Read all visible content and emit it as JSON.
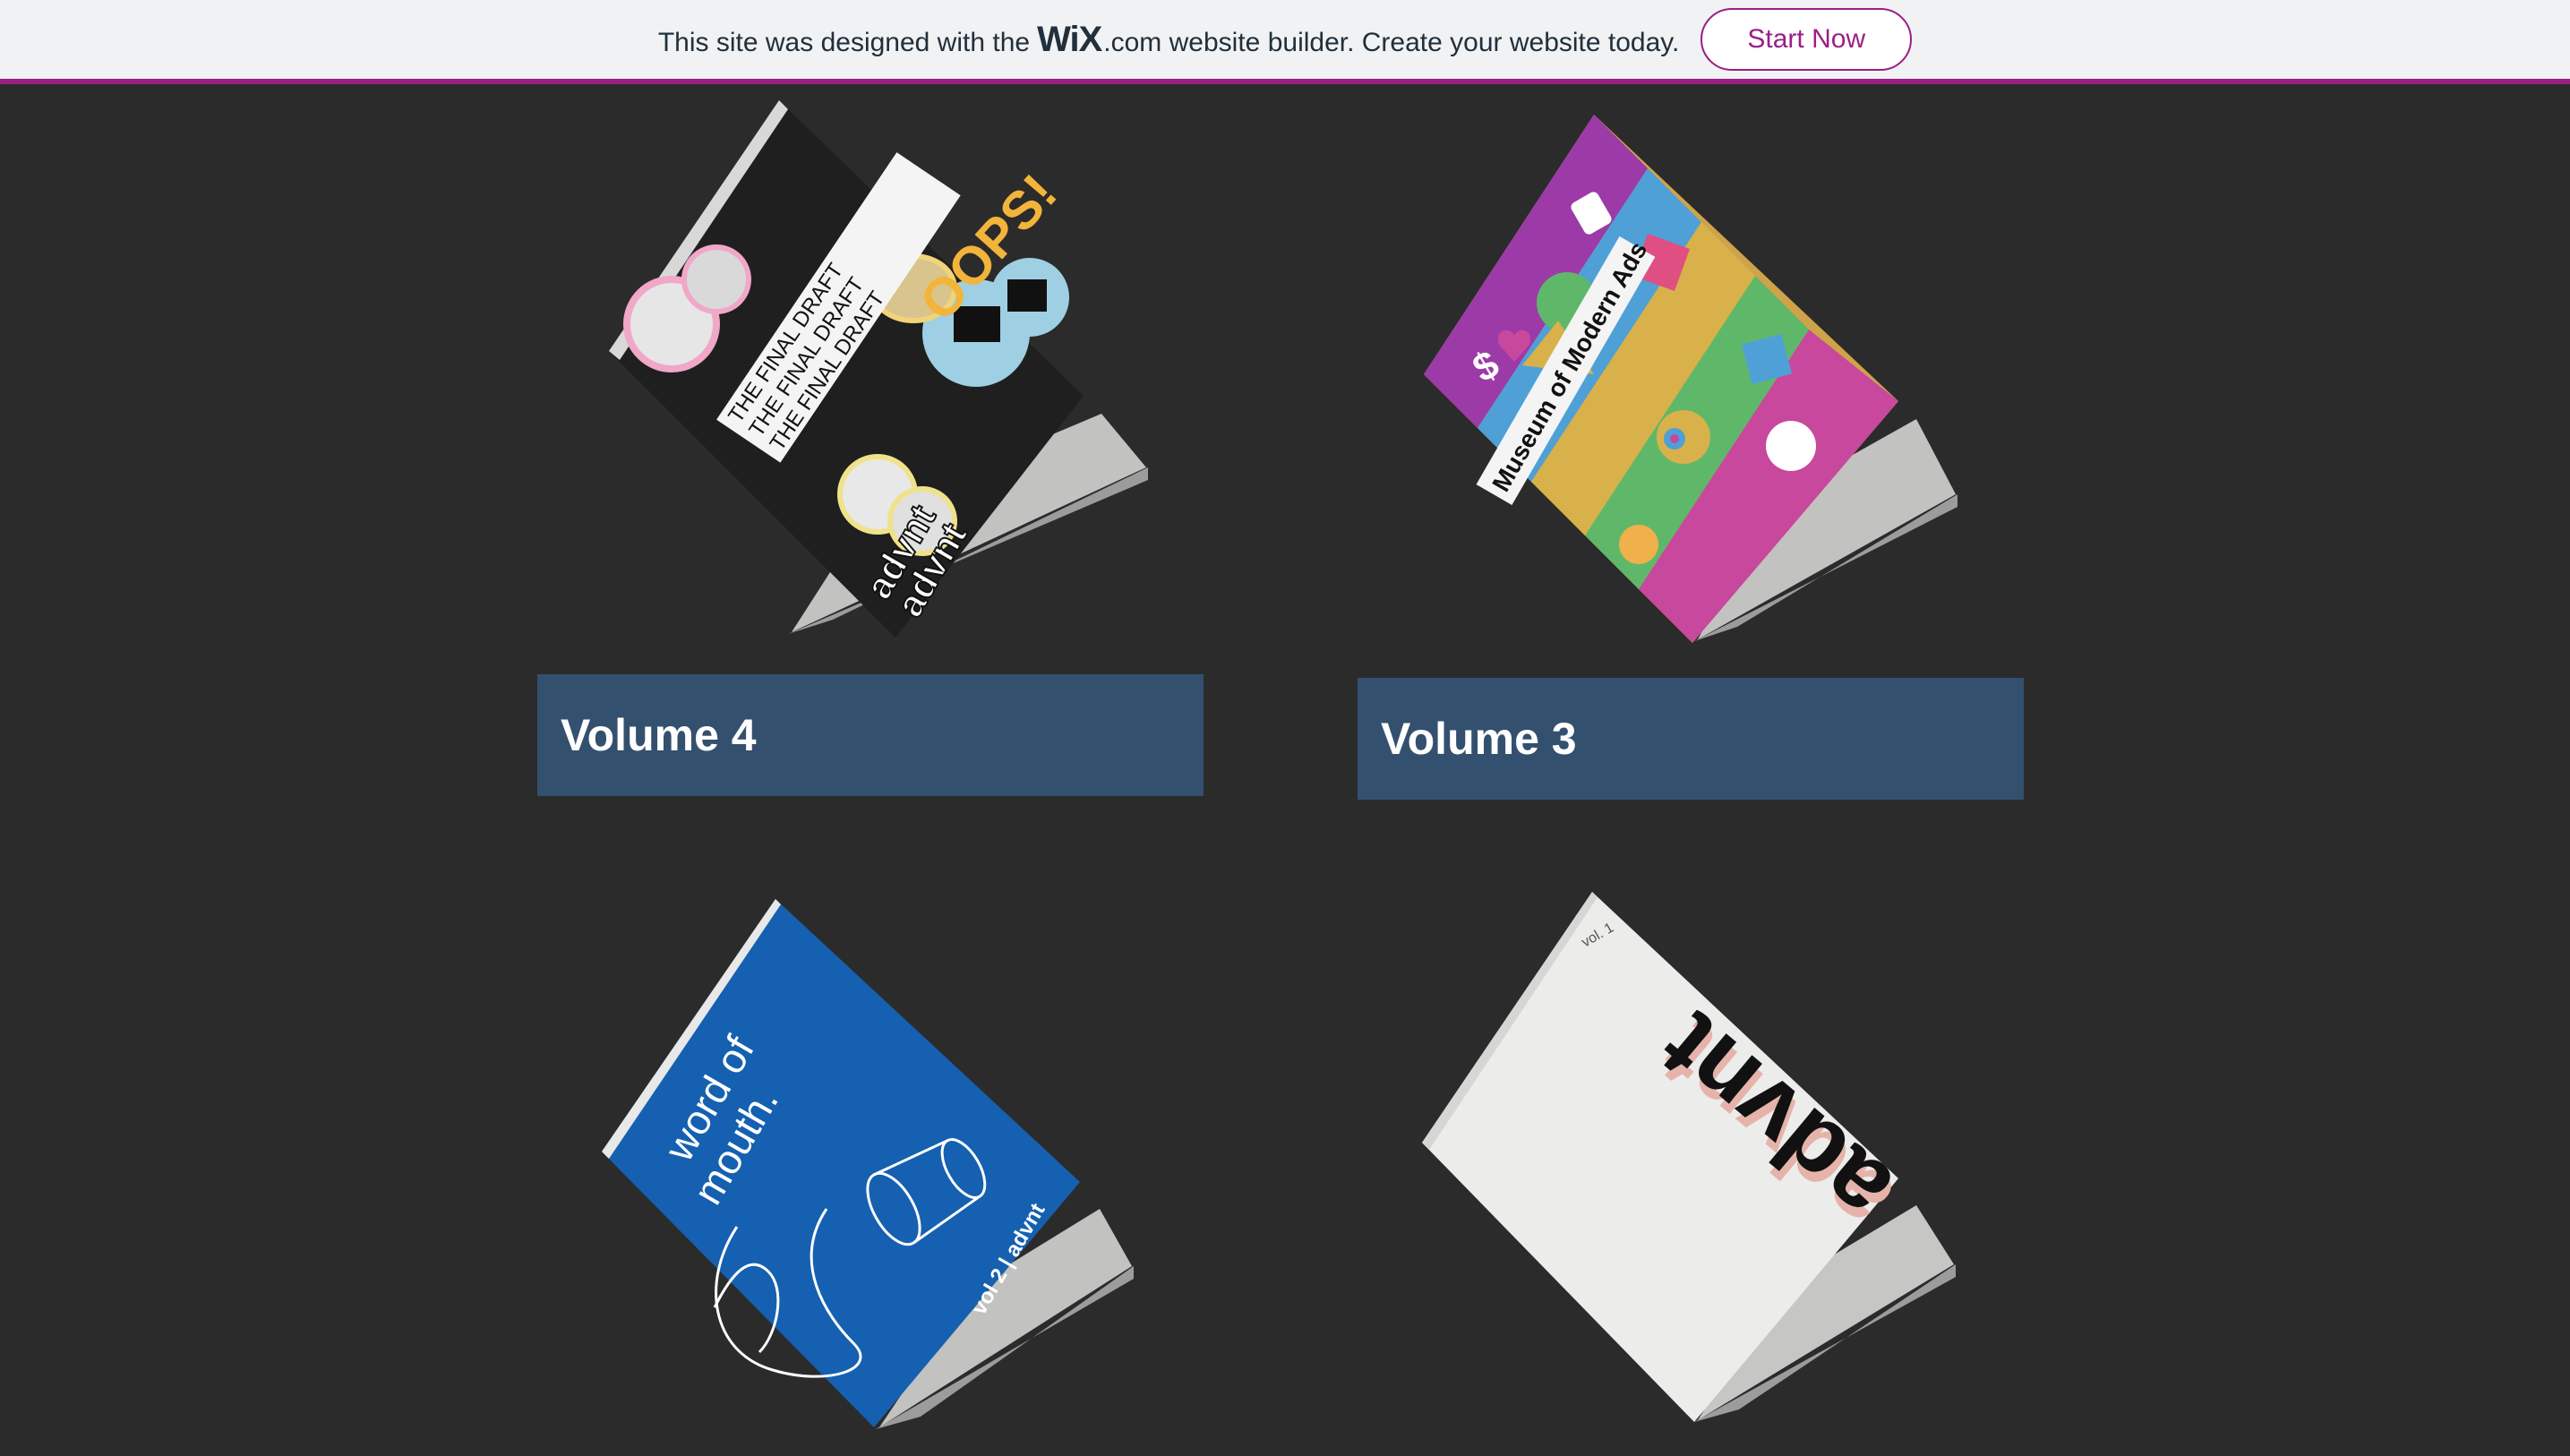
{
  "banner": {
    "prefix": "This site was designed with the",
    "brand": "WiX",
    "dotcom": ".com",
    "suffix": "website builder. Create your website today.",
    "cta_label": "Start Now",
    "accent": "#9a1f85"
  },
  "gallery": {
    "items": [
      {
        "title": "Volume 4",
        "cover_text": [
          "THE FINAL DRAFT",
          "THE FINAL DRAFT",
          "THE FINAL DRAFT"
        ],
        "cover_badge": "OOPS!",
        "cover_brand": "advnt"
      },
      {
        "title": "Volume 3",
        "cover_text": [
          "Museum of Modern Ads"
        ]
      },
      {
        "title": "",
        "cover_text": [
          "word of",
          "mouth."
        ],
        "cover_brand": "vol 2 | advnt"
      },
      {
        "title": "",
        "cover_text": [
          "advnt"
        ],
        "cover_badge": "vol. 1"
      }
    ]
  },
  "colors": {
    "background": "#2b2b2b",
    "title_box": "#34506f"
  }
}
